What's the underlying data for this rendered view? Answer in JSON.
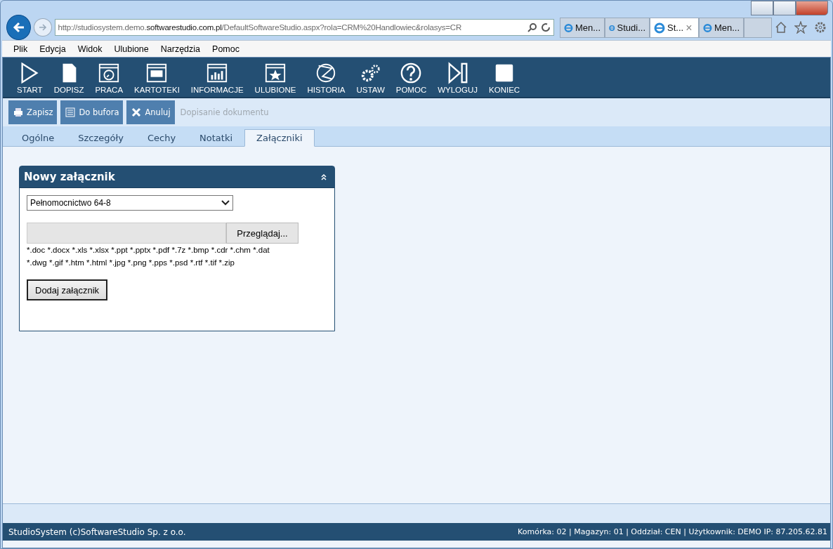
{
  "browser": {
    "address": "http://studiosystem.demo.**softwarestudio.com.pl**/DefaultSoftwareStudio.aspx?rola=CRM%20Handlowiec&rolasys=CR",
    "tabs": [
      {
        "label": "Men...",
        "selected": false
      },
      {
        "label": "Studi...",
        "selected": false
      },
      {
        "label": "St...",
        "selected": true,
        "close": "×"
      },
      {
        "label": "Men...",
        "selected": false
      }
    ],
    "menu": [
      "Plik",
      "Edycja",
      "Widok",
      "Ulubione",
      "Narzędzia",
      "Pomoc"
    ]
  },
  "toolbar": [
    "START",
    "DOPISZ",
    "PRACA",
    "KARTOTEKI",
    "INFORMACJE",
    "ULUBIONE",
    "HISTORIA",
    "USTAW",
    "POMOC",
    "WYLOGUJ",
    "KONIEC"
  ],
  "actions": {
    "buttons": [
      "Zapisz",
      "Do bufora",
      "Anuluj"
    ],
    "caption": "Dopisanie dokumentu"
  },
  "tabs": [
    {
      "label": "Ogólne",
      "selected": false
    },
    {
      "label": "Szczegóły",
      "selected": false
    },
    {
      "label": "Cechy",
      "selected": false
    },
    {
      "label": "Notatki",
      "selected": false
    },
    {
      "label": "Załączniki",
      "selected": true
    }
  ],
  "panel": {
    "title": "Nowy załącznik",
    "document_type": "Pełnomocnictwo 64-8",
    "browse_button": "Przeglądaj...",
    "extensions": [
      "*.doc *.docx *.xls *.xlsx *.ppt *.pptx *.pdf *.7z *.bmp *.cdr *.chm *.dat",
      "*.dwg *.gif *.htm *.html *.jpg *.png *.pps *.psd *.rtf *.tif *.zip"
    ],
    "add_button": "Dodaj załącznik"
  },
  "status_bar": {
    "left": "StudioSystem (c)SoftwareStudio Sp. z o.o.",
    "right": "Komórka: 02 | Magazyn: 01 | Oddział: CEN | Użytkownik: DEMO IP: 87.205.62.81"
  }
}
